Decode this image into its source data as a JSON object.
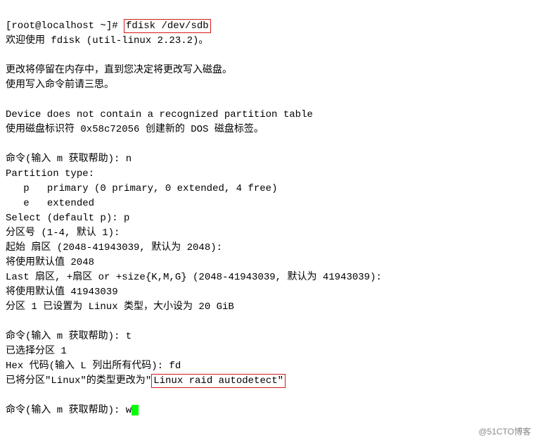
{
  "prompt": "[root@localhost ~]# ",
  "cmd": "fdisk /dev/sdb",
  "lines": {
    "welcome": "欢迎使用 fdisk (util-linux 2.23.2)。",
    "blank": "",
    "change_mem": "更改将停留在内存中，直到您决定将更改写入磁盘。",
    "think": "使用写入命令前请三思。",
    "no_table": "Device does not contain a recognized partition table",
    "dos_label": "使用磁盘标识符 0x58c72056 创建新的 DOS 磁盘标签。",
    "help_n": "命令(输入 m 获取帮助): n",
    "ptype_hdr": "Partition type:",
    "ptype_p": "   p   primary (0 primary, 0 extended, 4 free)",
    "ptype_e": "   e   extended",
    "select_p": "Select (default p): p",
    "part_num": "分区号 (1-4, 默认 1):",
    "first_sec": "起始 扇区 (2048-41943039, 默认为 2048):",
    "use_2048": "将使用默认值 2048",
    "last_sec": "Last 扇区, +扇区 or +size{K,M,G} (2048-41943039, 默认为 41943039):",
    "use_last": "将使用默认值 41943039",
    "part_set": "分区 1 已设置为 Linux 类型，大小设为 20 GiB",
    "help_t": "命令(输入 m 获取帮助): t",
    "sel_part1": "已选择分区 1",
    "hex_fd": "Hex 代码(输入 L 列出所有代码): fd",
    "changed_pre": "已将分区\"Linux\"的类型更改为",
    "changed_hl_open": "\"",
    "changed_hl": "Linux raid autodetect\"",
    "help_w_pre": "命令(输入 m 获取帮助): w"
  },
  "watermark": "@51CTO博客"
}
